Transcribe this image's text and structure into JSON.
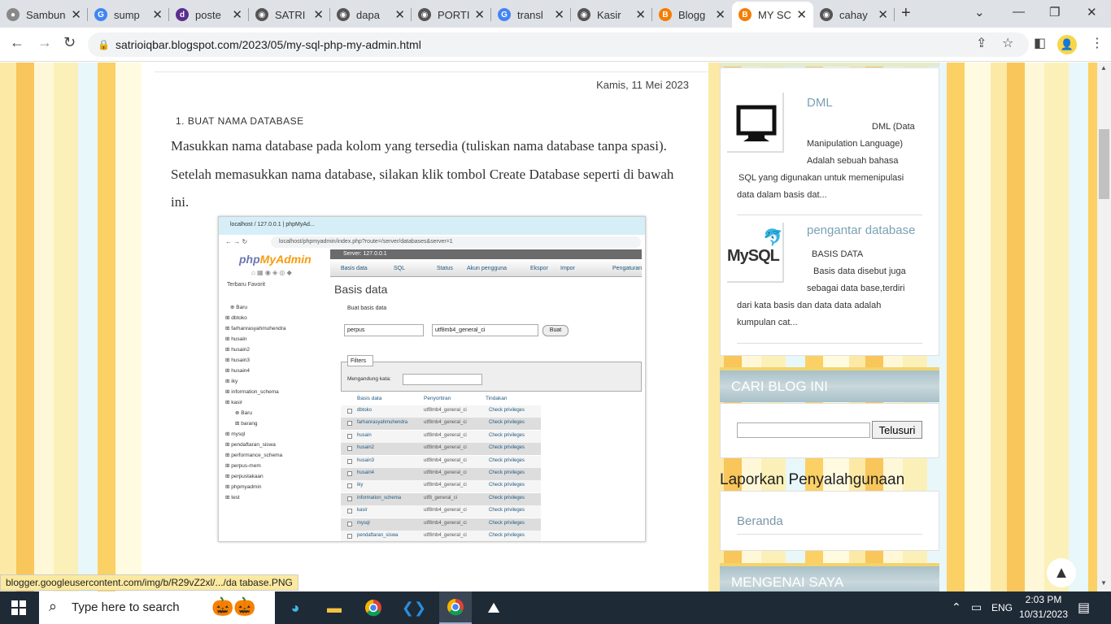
{
  "tabs": [
    {
      "label": "Sambungk",
      "color": "#888888",
      "glyph": "●"
    },
    {
      "label": "sump",
      "color": "#4285f4",
      "glyph": "G"
    },
    {
      "label": "poste",
      "color": "#5b2d8e",
      "glyph": "d"
    },
    {
      "label": "SATRI",
      "color": "#555555",
      "glyph": "◉"
    },
    {
      "label": "dapa",
      "color": "#555555",
      "glyph": "◉"
    },
    {
      "label": "PORTI",
      "color": "#555555",
      "glyph": "◉"
    },
    {
      "label": "transl",
      "color": "#4285f4",
      "glyph": "G"
    },
    {
      "label": "Kasir",
      "color": "#555555",
      "glyph": "◉"
    },
    {
      "label": "Blogg",
      "color": "#f57d00",
      "glyph": "B"
    },
    {
      "label": "MY SC",
      "color": "#f57d00",
      "glyph": "B"
    },
    {
      "label": "cahay",
      "color": "#555555",
      "glyph": "◉"
    }
  ],
  "url": "satrioiqbar.blogspot.com/2023/05/my-sql-php-my-admin.html",
  "post": {
    "date": "Kamis, 11 Mei 2023",
    "step": "1. BUAT NAMA DATABASE",
    "paragraph": "Masukkan nama database pada kolom yang tersedia (tuliskan nama database tanpa spasi). Setelah memasukkan nama database, silakan klik tombol Create Database seperti di bawah ini."
  },
  "shot": {
    "tab": "localhost / 127.0.0.1 | phpMyAd...",
    "url": "localhost/phpmyadmin/index.php?route=/server/databases&server=1",
    "logo_a": "php",
    "logo_b": "MyAdmin",
    "left_tabs": "Terbaru  Favorit",
    "server": "Server: 127.0.0.1",
    "nav": [
      "Basis data",
      "SQL",
      "Status",
      "Akun pengguna",
      "Ekspor",
      "Impor",
      "Pengaturan"
    ],
    "heading": "Basis data",
    "create_label": "Buat basis data",
    "db_input": "perpus",
    "collation": "utf8mb4_general_ci",
    "create_btn": "Buat",
    "filters": "Filters",
    "contains": "Mengandung kata:",
    "cols": [
      "Basis data",
      "Penyortiran",
      "Tindakan"
    ],
    "tree": [
      "Baru",
      "dbtoko",
      "farhanrasyahmuhendra",
      "husain",
      "husain2",
      "husain3",
      "husain4",
      "iky",
      "information_schema",
      "kasir",
      "Baru",
      "barang",
      "mysql",
      "pendaftaran_siswa",
      "performance_schema",
      "perpus-mem",
      "perpustakaan",
      "phpmyadmin",
      "test"
    ],
    "rows": [
      {
        "n": "dbtoko",
        "c": "utf8mb4_general_ci"
      },
      {
        "n": "farhanrasyahmuhendra",
        "c": "utf8mb4_general_ci"
      },
      {
        "n": "husain",
        "c": "utf8mb4_general_ci"
      },
      {
        "n": "husain2",
        "c": "utf8mb4_general_ci"
      },
      {
        "n": "husain3",
        "c": "utf8mb4_general_ci"
      },
      {
        "n": "husain4",
        "c": "utf8mb4_general_ci"
      },
      {
        "n": "iky",
        "c": "utf8mb4_general_ci"
      },
      {
        "n": "information_schema",
        "c": "utf8_general_ci"
      },
      {
        "n": "kasir",
        "c": "utf8mb4_general_ci"
      },
      {
        "n": "mysql",
        "c": "utf8mb4_general_ci"
      },
      {
        "n": "pendaftaran_siswa",
        "c": "utf8mb4_general_ci"
      }
    ],
    "action": "Check privileges"
  },
  "sidebar": {
    "p1": {
      "title": "DML",
      "l1": "DML (Data",
      "l2": "Manipulation Language)",
      "l3": "Adalah sebuah bahasa",
      "l4": "SQL yang digunakan untuk memenipulasi",
      "l5": "data dalam basis dat..."
    },
    "p2": {
      "title": "pengantar database",
      "logo": "MySQL",
      "l1": "BASIS DATA",
      "l2": "Basis data disebut juga",
      "l3": "sebagai data base,terdiri",
      "l4": "dari kata basis dan data data adalah",
      "l5": "kumpulan cat..."
    },
    "search_title": "CARI BLOG INI",
    "search_btn": "Telusuri",
    "report_title": "Laporkan Penyalahgunaan",
    "report_link": "Beranda",
    "about_title": "MENGENAI SAYA"
  },
  "status_url": "blogger.googleusercontent.com/img/b/R29vZ2xl/.../da tabase.PNG",
  "taskbar": {
    "search": "Type here to search",
    "lang": "ENG",
    "time": "2:03 PM",
    "date": "10/31/2023"
  }
}
